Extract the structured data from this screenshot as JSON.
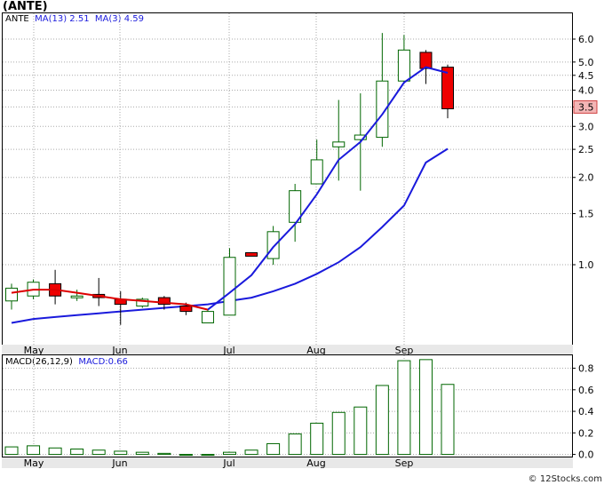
{
  "symbol_label": "(ANTE)",
  "footer": "© 12Stocks.com",
  "price_legend": {
    "ticker": "ANTE",
    "ma13_label": "MA(13)",
    "ma13_value": "2.51",
    "ma3_label": "MA(3)",
    "ma3_value": "4.59"
  },
  "macd_legend": {
    "label": "MACD(26,12,9)",
    "value_text": "MACD:0.66"
  },
  "last_price_tag": "3.5",
  "colors": {
    "up_candle_border": "#006600",
    "down_candle": "#ee0000",
    "ma13_line": "#1a1adc",
    "ma3_line": "#dd0000",
    "macd_bar": "#006600",
    "grid": "#aaaaaa"
  },
  "chart_data": [
    {
      "type": "candlestick",
      "title": "(ANTE)",
      "y_scale": "log",
      "y_ticks": [
        "6.0",
        "5.0",
        "4.5",
        "4.0",
        "3.5",
        "3.0",
        "2.5",
        "2.0",
        "1.5",
        "1.0"
      ],
      "x_months": [
        "May",
        "Jun",
        "Jul",
        "Aug",
        "Sep"
      ],
      "candles": [
        {
          "open": 0.75,
          "high": 0.86,
          "low": 0.7,
          "close": 0.83
        },
        {
          "open": 0.78,
          "high": 0.89,
          "low": 0.76,
          "close": 0.87
        },
        {
          "open": 0.86,
          "high": 0.96,
          "low": 0.73,
          "close": 0.78
        },
        {
          "open": 0.77,
          "high": 0.82,
          "low": 0.75,
          "close": 0.78
        },
        {
          "open": 0.79,
          "high": 0.9,
          "low": 0.72,
          "close": 0.77
        },
        {
          "open": 0.76,
          "high": 0.81,
          "low": 0.62,
          "close": 0.73
        },
        {
          "open": 0.72,
          "high": 0.77,
          "low": 0.71,
          "close": 0.76
        },
        {
          "open": 0.77,
          "high": 0.78,
          "low": 0.7,
          "close": 0.73
        },
        {
          "open": 0.72,
          "high": 0.74,
          "low": 0.67,
          "close": 0.69
        },
        {
          "open": 0.63,
          "high": 0.7,
          "low": 0.63,
          "close": 0.69
        },
        {
          "open": 0.67,
          "high": 1.14,
          "low": 0.67,
          "close": 1.06
        },
        {
          "open": 1.1,
          "high": 1.1,
          "low": 1.07,
          "close": 1.07
        },
        {
          "open": 1.05,
          "high": 1.36,
          "low": 1.0,
          "close": 1.3
        },
        {
          "open": 1.4,
          "high": 1.9,
          "low": 1.2,
          "close": 1.8
        },
        {
          "open": 1.9,
          "high": 2.7,
          "low": 1.9,
          "close": 2.3
        },
        {
          "open": 2.55,
          "high": 3.7,
          "low": 1.95,
          "close": 2.65
        },
        {
          "open": 2.7,
          "high": 3.9,
          "low": 1.8,
          "close": 2.8
        },
        {
          "open": 2.75,
          "high": 6.3,
          "low": 2.55,
          "close": 4.3
        },
        {
          "open": 4.3,
          "high": 6.2,
          "low": 4.2,
          "close": 5.5
        },
        {
          "open": 5.4,
          "high": 5.5,
          "low": 4.2,
          "close": 4.75
        },
        {
          "open": 4.8,
          "high": 4.9,
          "low": 3.2,
          "close": 3.45
        }
      ],
      "ma13_series": [
        {
          "i": 0,
          "v": 0.63
        },
        {
          "i": 1,
          "v": 0.65
        },
        {
          "i": 2,
          "v": 0.66
        },
        {
          "i": 3,
          "v": 0.67
        },
        {
          "i": 4,
          "v": 0.68
        },
        {
          "i": 5,
          "v": 0.69
        },
        {
          "i": 6,
          "v": 0.7
        },
        {
          "i": 7,
          "v": 0.71
        },
        {
          "i": 8,
          "v": 0.72
        },
        {
          "i": 9,
          "v": 0.73
        },
        {
          "i": 10,
          "v": 0.75
        },
        {
          "i": 11,
          "v": 0.77
        },
        {
          "i": 12,
          "v": 0.81
        },
        {
          "i": 13,
          "v": 0.86
        },
        {
          "i": 14,
          "v": 0.93
        },
        {
          "i": 15,
          "v": 1.02
        },
        {
          "i": 16,
          "v": 1.15
        },
        {
          "i": 17,
          "v": 1.35
        },
        {
          "i": 18,
          "v": 1.6
        },
        {
          "i": 19,
          "v": 2.25
        },
        {
          "i": 20,
          "v": 2.51
        }
      ],
      "ma3_series": [
        {
          "i": 0,
          "v": 0.8
        },
        {
          "i": 1,
          "v": 0.82
        },
        {
          "i": 2,
          "v": 0.82
        },
        {
          "i": 3,
          "v": 0.8
        },
        {
          "i": 4,
          "v": 0.78
        },
        {
          "i": 5,
          "v": 0.76
        },
        {
          "i": 6,
          "v": 0.75
        },
        {
          "i": 7,
          "v": 0.74
        },
        {
          "i": 8,
          "v": 0.73
        },
        {
          "i": 9,
          "v": 0.7
        }
      ],
      "ma3_series_b": [
        {
          "i": 9,
          "v": 0.7
        },
        {
          "i": 10,
          "v": 0.8
        },
        {
          "i": 11,
          "v": 0.92
        },
        {
          "i": 12,
          "v": 1.15
        },
        {
          "i": 13,
          "v": 1.38
        },
        {
          "i": 14,
          "v": 1.75
        },
        {
          "i": 15,
          "v": 2.3
        },
        {
          "i": 16,
          "v": 2.65
        },
        {
          "i": 17,
          "v": 3.3
        },
        {
          "i": 18,
          "v": 4.25
        },
        {
          "i": 19,
          "v": 4.8
        },
        {
          "i": 20,
          "v": 4.59
        }
      ]
    },
    {
      "type": "bar",
      "title": "MACD(26,12,9)",
      "y_ticks": [
        "0.8",
        "0.6",
        "0.4",
        "0.2",
        "0.0"
      ],
      "ylim": [
        -0.02,
        0.92
      ],
      "x_months": [
        "May",
        "Jun",
        "Jul",
        "Aug",
        "Sep"
      ],
      "values": [
        0.07,
        0.08,
        0.06,
        0.05,
        0.04,
        0.03,
        0.02,
        0.01,
        0.0,
        0.0,
        0.02,
        0.04,
        0.1,
        0.19,
        0.29,
        0.39,
        0.44,
        0.64,
        0.87,
        0.88,
        0.65
      ]
    }
  ]
}
